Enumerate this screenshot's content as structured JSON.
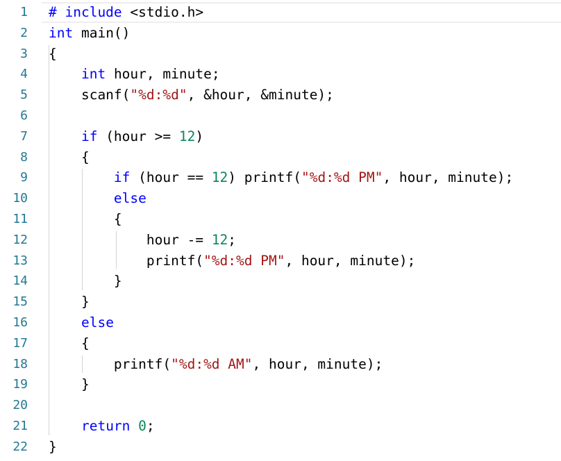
{
  "editor": {
    "lines": [
      {
        "number": "1",
        "tokens": [
          {
            "t": "# include",
            "c": "pp"
          },
          {
            "t": " <stdio.h>",
            "c": ""
          }
        ]
      },
      {
        "number": "2",
        "tokens": [
          {
            "t": "int",
            "c": "kw"
          },
          {
            "t": " main()",
            "c": ""
          }
        ]
      },
      {
        "number": "3",
        "tokens": [
          {
            "t": "{",
            "c": ""
          }
        ]
      },
      {
        "number": "4",
        "tokens": [
          {
            "t": "    ",
            "c": ""
          },
          {
            "t": "int",
            "c": "kw"
          },
          {
            "t": " hour, minute;",
            "c": ""
          }
        ]
      },
      {
        "number": "5",
        "tokens": [
          {
            "t": "    scanf(",
            "c": ""
          },
          {
            "t": "\"%d:%d\"",
            "c": "str"
          },
          {
            "t": ", &hour, &minute);",
            "c": ""
          }
        ]
      },
      {
        "number": "6",
        "tokens": []
      },
      {
        "number": "7",
        "tokens": [
          {
            "t": "    ",
            "c": ""
          },
          {
            "t": "if",
            "c": "kw"
          },
          {
            "t": " (hour >= ",
            "c": ""
          },
          {
            "t": "12",
            "c": "num"
          },
          {
            "t": ")",
            "c": ""
          }
        ]
      },
      {
        "number": "8",
        "tokens": [
          {
            "t": "    {",
            "c": ""
          }
        ]
      },
      {
        "number": "9",
        "tokens": [
          {
            "t": "        ",
            "c": ""
          },
          {
            "t": "if",
            "c": "kw"
          },
          {
            "t": " (hour == ",
            "c": ""
          },
          {
            "t": "12",
            "c": "num"
          },
          {
            "t": ") printf(",
            "c": ""
          },
          {
            "t": "\"%d:%d PM\"",
            "c": "str"
          },
          {
            "t": ", hour, minute);",
            "c": ""
          }
        ]
      },
      {
        "number": "10",
        "tokens": [
          {
            "t": "        ",
            "c": ""
          },
          {
            "t": "else",
            "c": "kw"
          }
        ]
      },
      {
        "number": "11",
        "tokens": [
          {
            "t": "        {",
            "c": ""
          }
        ]
      },
      {
        "number": "12",
        "tokens": [
          {
            "t": "            hour -= ",
            "c": ""
          },
          {
            "t": "12",
            "c": "num"
          },
          {
            "t": ";",
            "c": ""
          }
        ]
      },
      {
        "number": "13",
        "tokens": [
          {
            "t": "            printf(",
            "c": ""
          },
          {
            "t": "\"%d:%d PM\"",
            "c": "str"
          },
          {
            "t": ", hour, minute);",
            "c": ""
          }
        ]
      },
      {
        "number": "14",
        "tokens": [
          {
            "t": "        }",
            "c": ""
          }
        ]
      },
      {
        "number": "15",
        "tokens": [
          {
            "t": "    }",
            "c": ""
          }
        ]
      },
      {
        "number": "16",
        "tokens": [
          {
            "t": "    ",
            "c": ""
          },
          {
            "t": "else",
            "c": "kw"
          }
        ]
      },
      {
        "number": "17",
        "tokens": [
          {
            "t": "    {",
            "c": ""
          }
        ]
      },
      {
        "number": "18",
        "tokens": [
          {
            "t": "        printf(",
            "c": ""
          },
          {
            "t": "\"%d:%d AM\"",
            "c": "str"
          },
          {
            "t": ", hour, minute);",
            "c": ""
          }
        ]
      },
      {
        "number": "19",
        "tokens": [
          {
            "t": "    }",
            "c": ""
          }
        ]
      },
      {
        "number": "20",
        "tokens": []
      },
      {
        "number": "21",
        "tokens": [
          {
            "t": "    ",
            "c": ""
          },
          {
            "t": "return",
            "c": "kw"
          },
          {
            "t": " ",
            "c": ""
          },
          {
            "t": "0",
            "c": "num"
          },
          {
            "t": ";",
            "c": ""
          }
        ]
      },
      {
        "number": "22",
        "tokens": [
          {
            "t": "}",
            "c": ""
          }
        ]
      }
    ],
    "colors": {
      "keyword": "#0000ff",
      "string": "#a31515",
      "number": "#098658",
      "line_number": "#237893",
      "text": "#000000"
    }
  }
}
